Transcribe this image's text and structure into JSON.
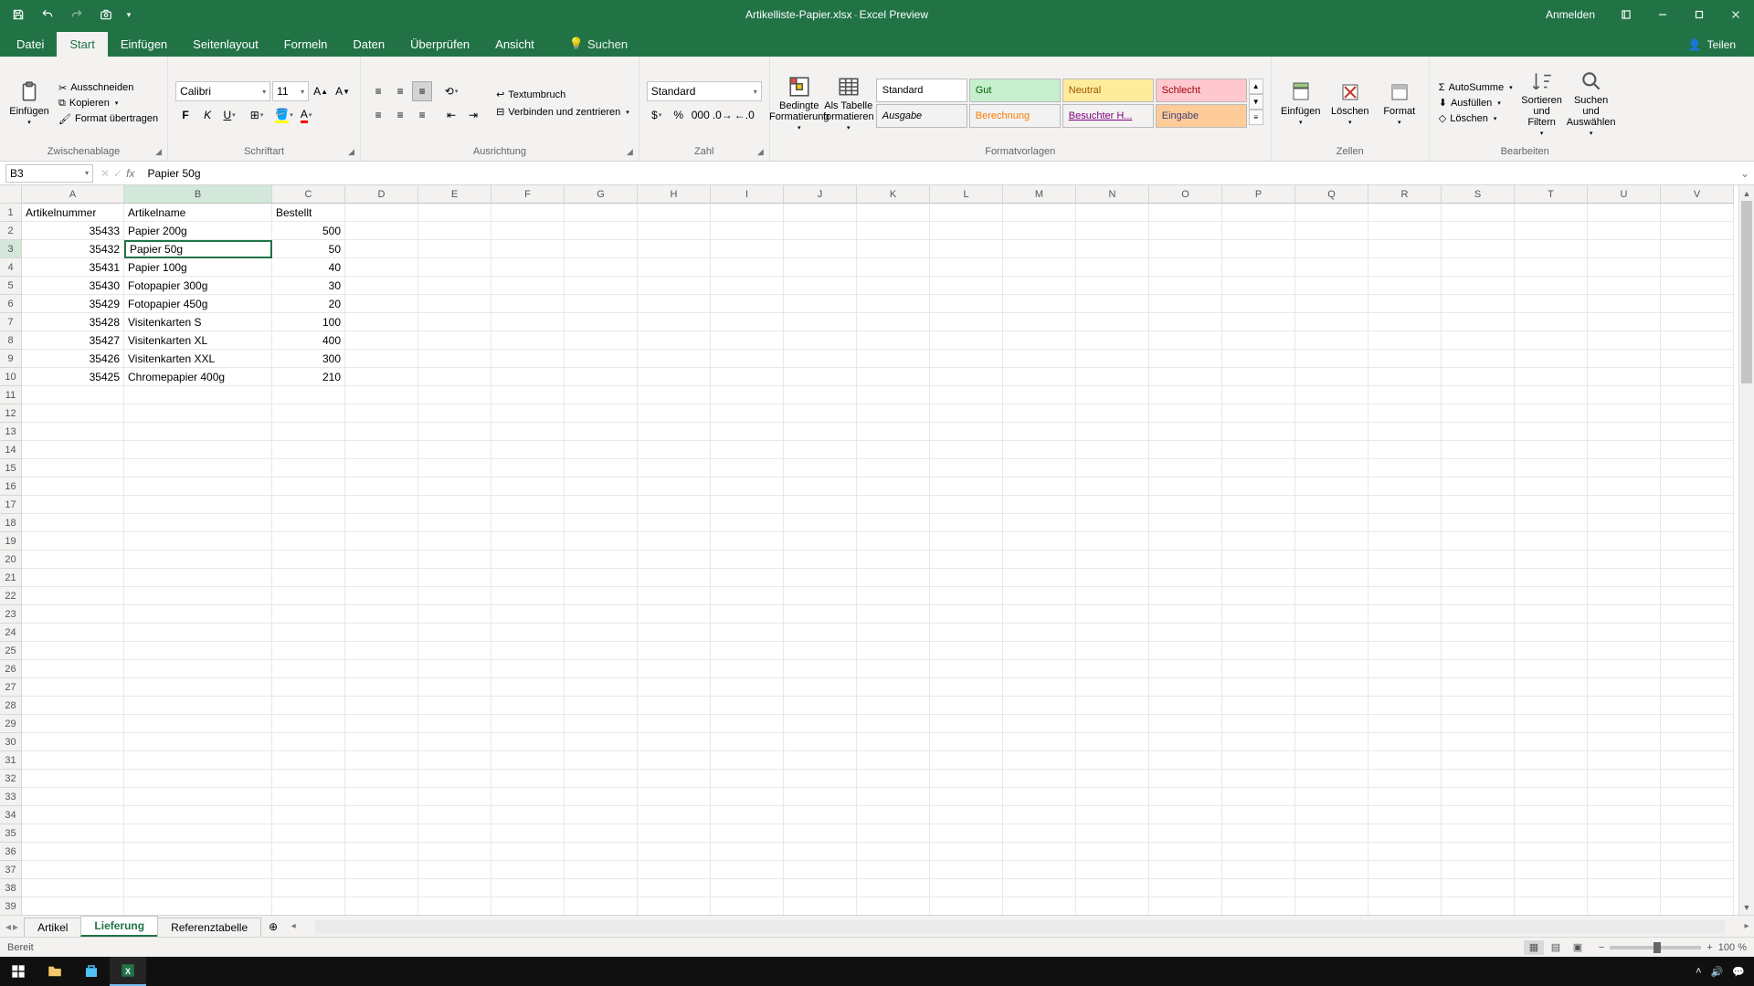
{
  "titlebar": {
    "filename": "Artikelliste-Papier.xlsx",
    "appname": "Excel Preview",
    "signin": "Anmelden"
  },
  "tabs": {
    "file": "Datei",
    "home": "Start",
    "insert": "Einfügen",
    "pagelayout": "Seitenlayout",
    "formulas": "Formeln",
    "data": "Daten",
    "review": "Überprüfen",
    "view": "Ansicht",
    "search": "Suchen",
    "share": "Teilen"
  },
  "ribbon": {
    "paste": "Einfügen",
    "cut": "Ausschneiden",
    "copy": "Kopieren",
    "format_painter": "Format übertragen",
    "clipboard_label": "Zwischenablage",
    "font_name": "Calibri",
    "font_size": "11",
    "font_label": "Schriftart",
    "wrap": "Textumbruch",
    "merge": "Verbinden und zentrieren",
    "align_label": "Ausrichtung",
    "number_format": "Standard",
    "number_label": "Zahl",
    "cond_format": "Bedingte Formatierung",
    "as_table": "Als Tabelle formatieren",
    "styles": {
      "standard": "Standard",
      "gut": "Gut",
      "neutral": "Neutral",
      "schlecht": "Schlecht",
      "ausgabe": "Ausgabe",
      "berechnung": "Berechnung",
      "besucht": "Besuchter H...",
      "eingabe": "Eingabe"
    },
    "styles_label": "Formatvorlagen",
    "insert_btn": "Einfügen",
    "delete_btn": "Löschen",
    "format_btn": "Format",
    "cells_label": "Zellen",
    "autosum": "AutoSumme",
    "fill": "Ausfüllen",
    "clear": "Löschen",
    "sort_filter": "Sortieren und Filtern",
    "find_select": "Suchen und Auswählen",
    "editing_label": "Bearbeiten"
  },
  "formula": {
    "namebox": "B3",
    "content": "Papier 50g"
  },
  "columns": [
    "A",
    "B",
    "C",
    "D",
    "E",
    "F",
    "G",
    "H",
    "I",
    "J",
    "K",
    "L",
    "M",
    "N",
    "O",
    "P",
    "Q",
    "R",
    "S",
    "T",
    "U",
    "V"
  ],
  "col_widths": {
    "A": "w-A",
    "B": "w-B",
    "C": "w-C"
  },
  "rows": [
    {
      "n": 1,
      "A": "Artikelnummer",
      "B": "Artikelname",
      "C": "Bestellt",
      "c_align": "left"
    },
    {
      "n": 2,
      "A": "35433",
      "B": "Papier 200g",
      "C": "500"
    },
    {
      "n": 3,
      "A": "35432",
      "B": "Papier 50g",
      "C": "50",
      "sel": "B"
    },
    {
      "n": 4,
      "A": "35431",
      "B": "Papier 100g",
      "C": "40"
    },
    {
      "n": 5,
      "A": "35430",
      "B": "Fotopapier 300g",
      "C": "30"
    },
    {
      "n": 6,
      "A": "35429",
      "B": "Fotopapier 450g",
      "C": "20"
    },
    {
      "n": 7,
      "A": "35428",
      "B": "Visitenkarten S",
      "C": "100"
    },
    {
      "n": 8,
      "A": "35427",
      "B": "Visitenkarten XL",
      "C": "400"
    },
    {
      "n": 9,
      "A": "35426",
      "B": "Visitenkarten XXL",
      "C": "300"
    },
    {
      "n": 10,
      "A": "35425",
      "B": "Chromepapier 400g",
      "C": "210"
    }
  ],
  "total_rows": 39,
  "selected_col": "B",
  "selected_row": 3,
  "sheets": {
    "items": [
      "Artikel",
      "Lieferung",
      "Referenztabelle"
    ],
    "active": 1
  },
  "status": {
    "ready": "Bereit",
    "zoom": "100 %"
  }
}
